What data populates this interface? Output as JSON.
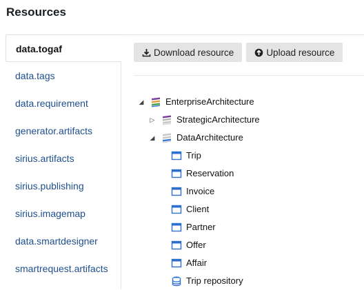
{
  "page": {
    "title": "Resources"
  },
  "sidebar": {
    "items": [
      {
        "label": "data.togaf",
        "active": true
      },
      {
        "label": "data.tags"
      },
      {
        "label": "data.requirement"
      },
      {
        "label": "generator.artifacts"
      },
      {
        "label": "sirius.artifacts"
      },
      {
        "label": "sirius.publishing"
      },
      {
        "label": "sirius.imagemap"
      },
      {
        "label": "data.smartdesigner"
      },
      {
        "label": "smartrequest.artifacts"
      }
    ]
  },
  "toolbar": {
    "download_label": "Download resource",
    "download_icon": "download-icon",
    "upload_label": "Upload resource",
    "upload_icon": "upload-icon"
  },
  "tree": {
    "root": {
      "label": "EnterpriseArchitecture",
      "expanded": true,
      "icon": "layers-icon"
    },
    "children": [
      {
        "label": "StrategicArchitecture",
        "expanded": false,
        "icon": "layers-icon"
      },
      {
        "label": "DataArchitecture",
        "expanded": true,
        "icon": "layers-icon"
      }
    ],
    "entities": [
      {
        "label": "Trip",
        "icon": "entity-icon"
      },
      {
        "label": "Reservation",
        "icon": "entity-icon"
      },
      {
        "label": "Invoice",
        "icon": "entity-icon"
      },
      {
        "label": "Client",
        "icon": "entity-icon"
      },
      {
        "label": "Partner",
        "icon": "entity-icon"
      },
      {
        "label": "Offer",
        "icon": "entity-icon"
      },
      {
        "label": "Affair",
        "icon": "entity-icon"
      },
      {
        "label": "Trip repository",
        "icon": "database-icon"
      }
    ]
  },
  "colors": {
    "link": "#1f4e8c",
    "entity_blue": "#2b6fd1",
    "button_bg": "#e4e4e4"
  }
}
